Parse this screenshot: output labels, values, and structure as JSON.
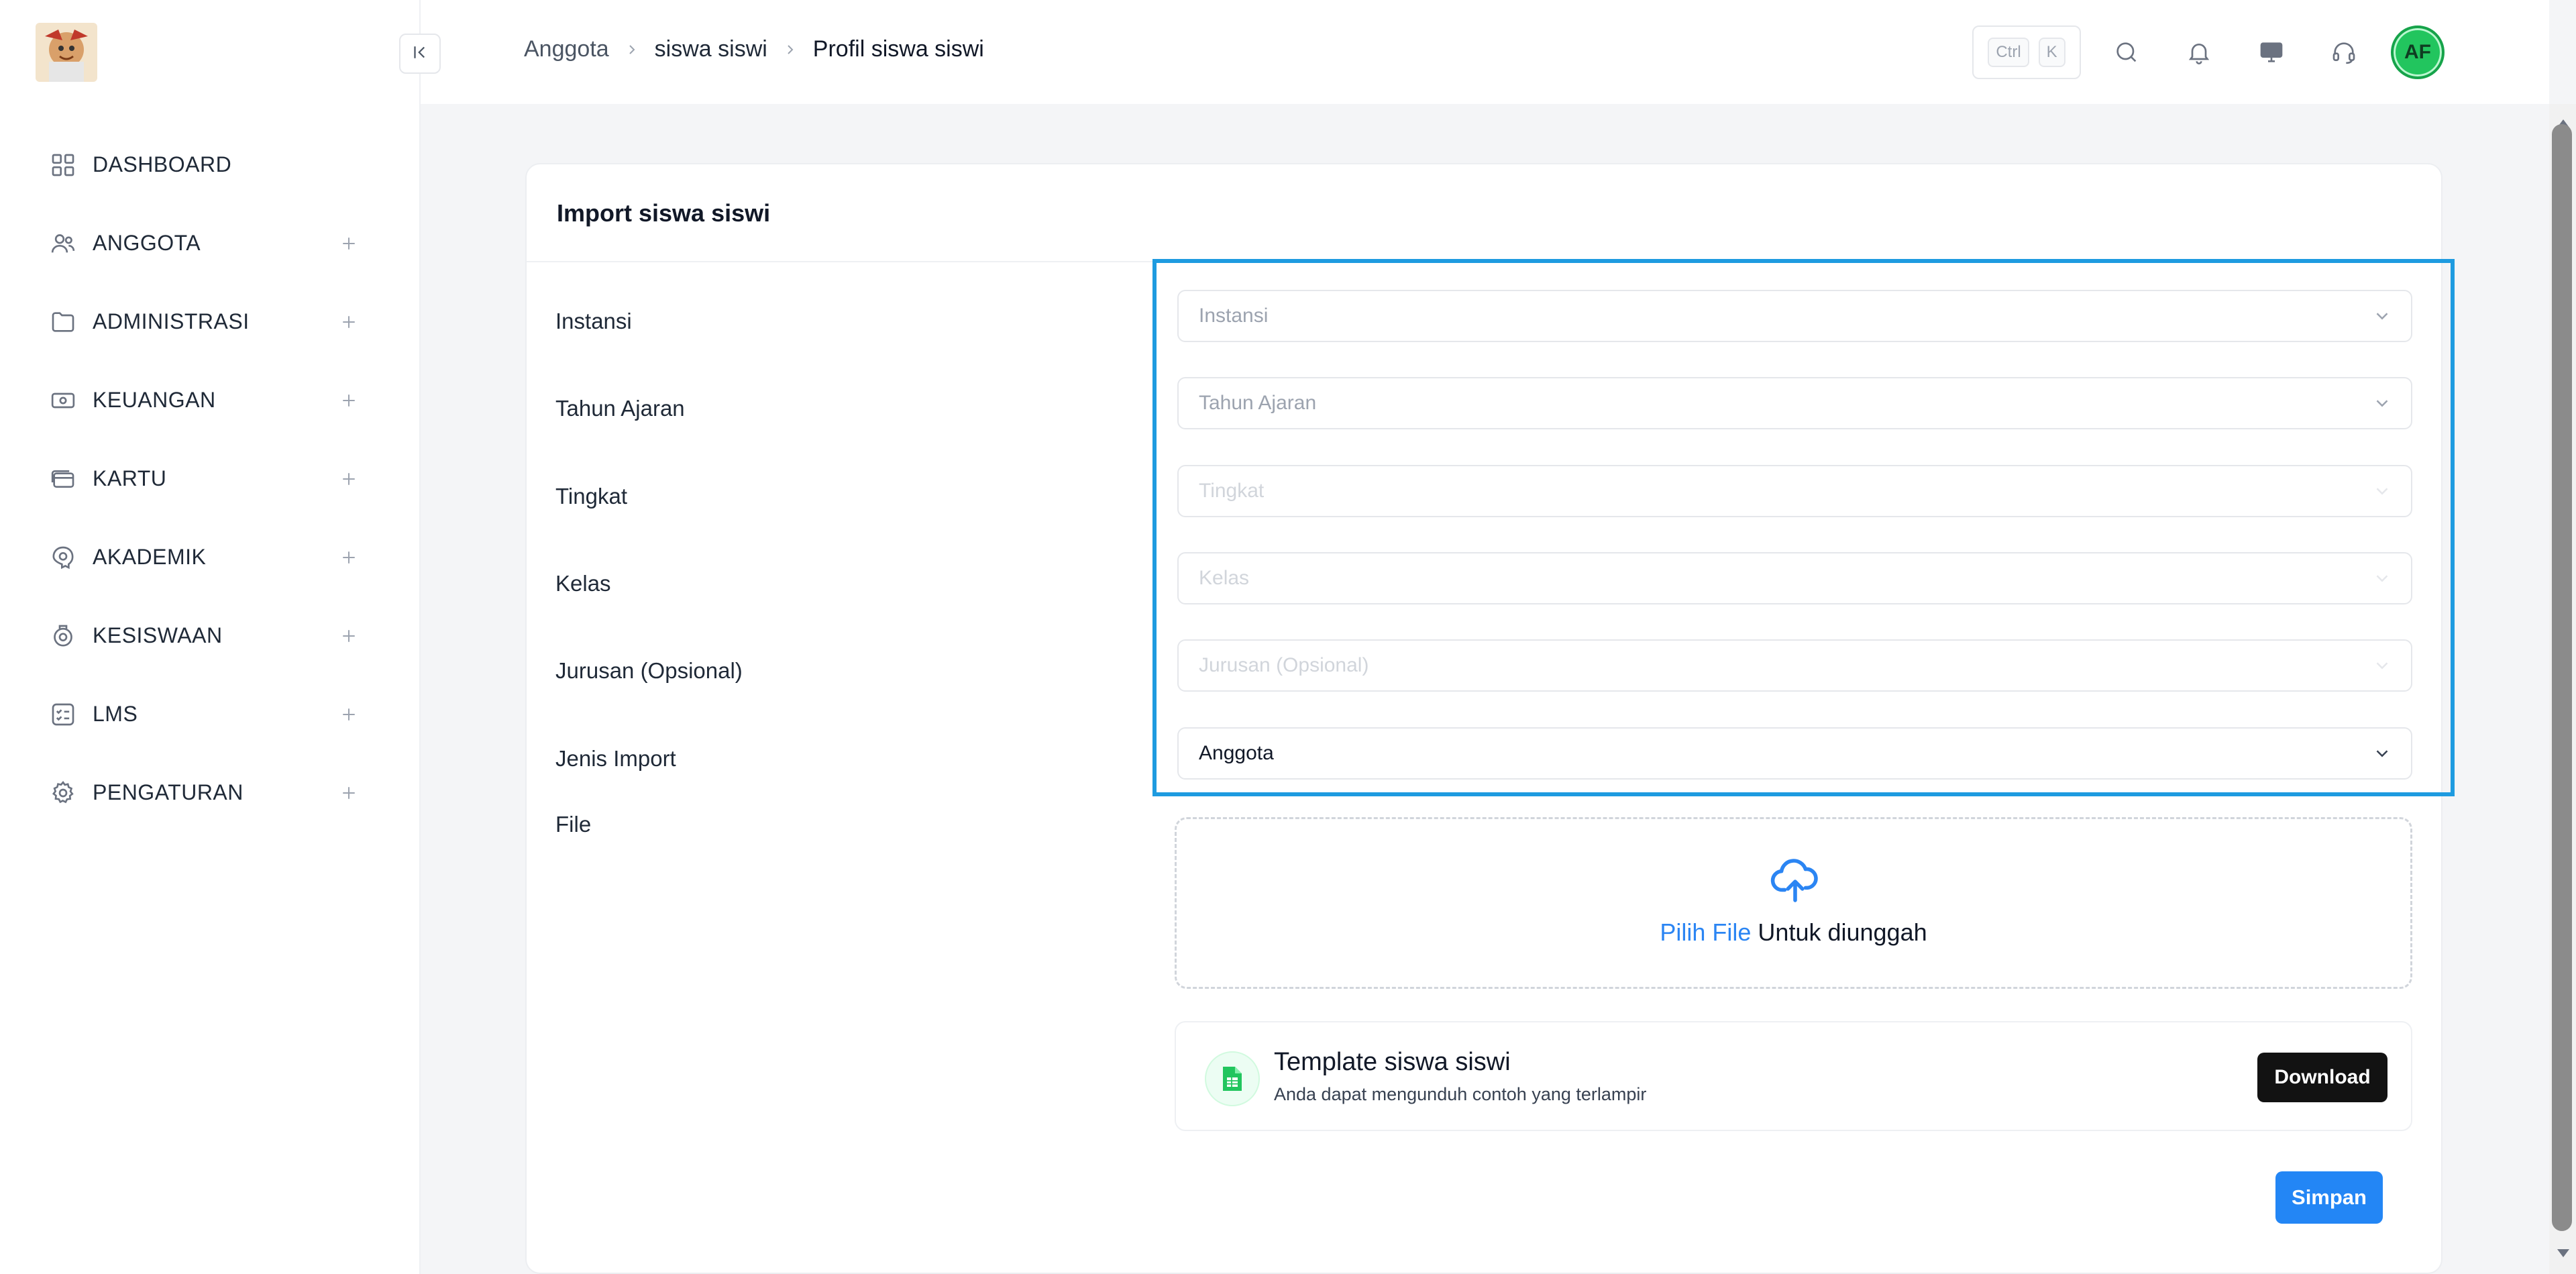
{
  "sidebar": {
    "items": [
      {
        "label": "DASHBOARD",
        "icon": "grid-icon",
        "expandable": false
      },
      {
        "label": "ANGGOTA",
        "icon": "users-icon",
        "expandable": true
      },
      {
        "label": "ADMINISTRASI",
        "icon": "folder-icon",
        "expandable": true
      },
      {
        "label": "KEUANGAN",
        "icon": "money-icon",
        "expandable": true
      },
      {
        "label": "KARTU",
        "icon": "card-icon",
        "expandable": true
      },
      {
        "label": "AKADEMIK",
        "icon": "academic-icon",
        "expandable": true
      },
      {
        "label": "KESISWAAN",
        "icon": "student-icon",
        "expandable": true
      },
      {
        "label": "LMS",
        "icon": "checklist-icon",
        "expandable": true
      },
      {
        "label": "PENGATURAN",
        "icon": "gear-icon",
        "expandable": true
      }
    ]
  },
  "header": {
    "breadcrumbs": [
      "Anggota",
      "siswa siswi",
      "Profil siswa siswi"
    ],
    "shortcut": {
      "key1": "Ctrl",
      "key2": "K"
    },
    "avatar_initials": "AF"
  },
  "form": {
    "title": "Import siswa siswi",
    "fields": [
      {
        "label": "Instansi",
        "placeholder": "Instansi",
        "state": "empty"
      },
      {
        "label": "Tahun Ajaran",
        "placeholder": "Tahun Ajaran",
        "state": "empty"
      },
      {
        "label": "Tingkat",
        "placeholder": "Tingkat",
        "state": "disabled"
      },
      {
        "label": "Kelas",
        "placeholder": "Kelas",
        "state": "disabled"
      },
      {
        "label": "Jurusan (Opsional)",
        "placeholder": "Jurusan (Opsional)",
        "state": "disabled"
      },
      {
        "label": "Jenis Import",
        "value": "Anggota",
        "state": "filled"
      }
    ],
    "file_label": "File",
    "upload": {
      "pick": "Pilih File",
      "rest": " Untuk diunggah"
    },
    "template": {
      "title": "Template siswa siswi",
      "subtitle": "Anda dapat mengunduh contoh yang terlampir",
      "download_label": "Download"
    },
    "save_label": "Simpan"
  },
  "colors": {
    "accent": "#2386f5",
    "highlight": "#1e9be0",
    "download_bg": "#121212"
  }
}
